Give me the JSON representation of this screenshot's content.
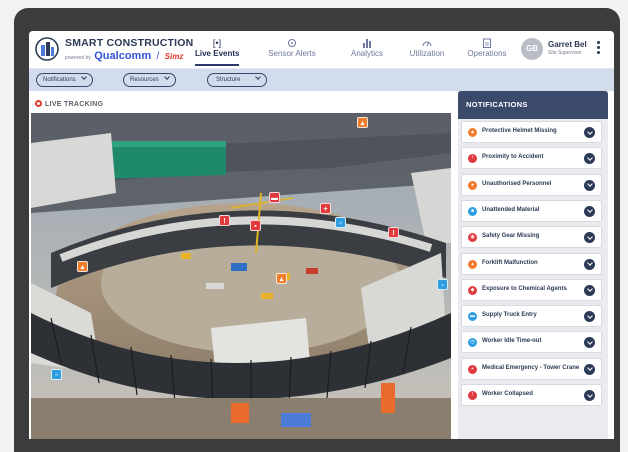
{
  "app": {
    "title": "SMART CONSTRUCTION",
    "powered_by": "powered by",
    "partner_1": "Qualcomm",
    "separator": "/",
    "partner_2": "Simz"
  },
  "nav": [
    {
      "label": "Live Events",
      "icon": "live-events-icon",
      "active": true
    },
    {
      "label": "Sensor Alerts",
      "icon": "sensor-icon",
      "active": false
    },
    {
      "label": "Analytics",
      "icon": "bar-chart-icon",
      "active": false
    },
    {
      "label": "Utilization",
      "icon": "gauge-icon",
      "active": false
    },
    {
      "label": "Operations",
      "icon": "clipboard-icon",
      "active": false
    }
  ],
  "user": {
    "initials": "GB",
    "name": "Garret Bel",
    "role": "Site Supervisor"
  },
  "filters": [
    {
      "label": "Notifications"
    },
    {
      "label": "Resources"
    },
    {
      "label": "Structure"
    }
  ],
  "live": {
    "title": "LIVE TRACKING"
  },
  "notifications": {
    "title": "NOTIFICATIONS",
    "items": [
      {
        "label": "Protective Helmet Missing",
        "color": "#f07d2e",
        "icon": "helmet-icon"
      },
      {
        "label": "Proximity to Accident",
        "color": "#e03a3f",
        "icon": "warning-icon"
      },
      {
        "label": "Unauthorised Personnel",
        "color": "#f07d2e",
        "icon": "person-icon"
      },
      {
        "label": "Unattended Material",
        "color": "#2e9ee0",
        "icon": "box-icon"
      },
      {
        "label": "Safety Gear Missing",
        "color": "#e03a3f",
        "icon": "goggles-icon"
      },
      {
        "label": "Forklift Malfunction",
        "color": "#f07d2e",
        "icon": "forklift-icon"
      },
      {
        "label": "Exposure to Chemical Agents",
        "color": "#e03a3f",
        "icon": "chemical-icon"
      },
      {
        "label": "Supply Truck Entry",
        "color": "#2e9ee0",
        "icon": "truck-icon"
      },
      {
        "label": "Worker Idle Time-out",
        "color": "#2e9ee0",
        "icon": "clock-icon"
      },
      {
        "label": "Medical Emergency - Tower Crane",
        "color": "#e03a3f",
        "icon": "medical-icon"
      },
      {
        "label": "Worker Collapsed",
        "color": "#e03a3f",
        "icon": "alert-icon"
      }
    ]
  },
  "colors": {
    "accent": "#2b3a55",
    "panel_header": "#3b4a6b",
    "orange": "#f07d2e",
    "red": "#e03a3f",
    "blue": "#2e9ee0"
  }
}
